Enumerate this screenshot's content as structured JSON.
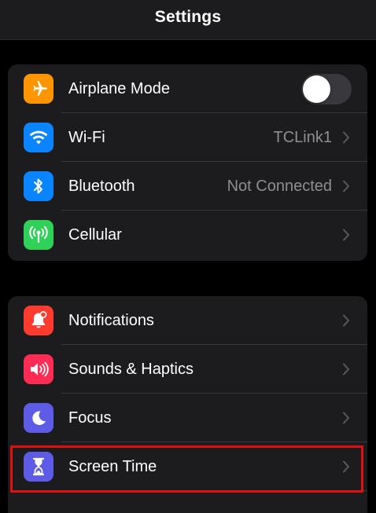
{
  "navbar": {
    "title": "Settings"
  },
  "colors": {
    "airplane": "#ff9500",
    "wifi": "#0a84ff",
    "bluetooth": "#0a84ff",
    "cellular": "#30d158",
    "notifications": "#ff3b30",
    "sounds": "#ff2d55",
    "focus": "#5e5ce6",
    "screen_time": "#5e5ce6",
    "highlight": "#e01010"
  },
  "group1": {
    "airplane": {
      "label": "Airplane Mode",
      "icon": "airplane-icon",
      "toggle_on": false
    },
    "wifi": {
      "label": "Wi-Fi",
      "value": "TCLink1",
      "icon": "wifi-icon"
    },
    "bluetooth": {
      "label": "Bluetooth",
      "value": "Not Connected",
      "icon": "bluetooth-icon"
    },
    "cellular": {
      "label": "Cellular",
      "icon": "cellular-antenna-icon"
    }
  },
  "group2": {
    "notifications": {
      "label": "Notifications",
      "icon": "bell-icon"
    },
    "sounds": {
      "label": "Sounds & Haptics",
      "icon": "speaker-icon"
    },
    "focus": {
      "label": "Focus",
      "icon": "moon-icon"
    },
    "screen_time": {
      "label": "Screen Time",
      "icon": "hourglass-icon"
    }
  }
}
